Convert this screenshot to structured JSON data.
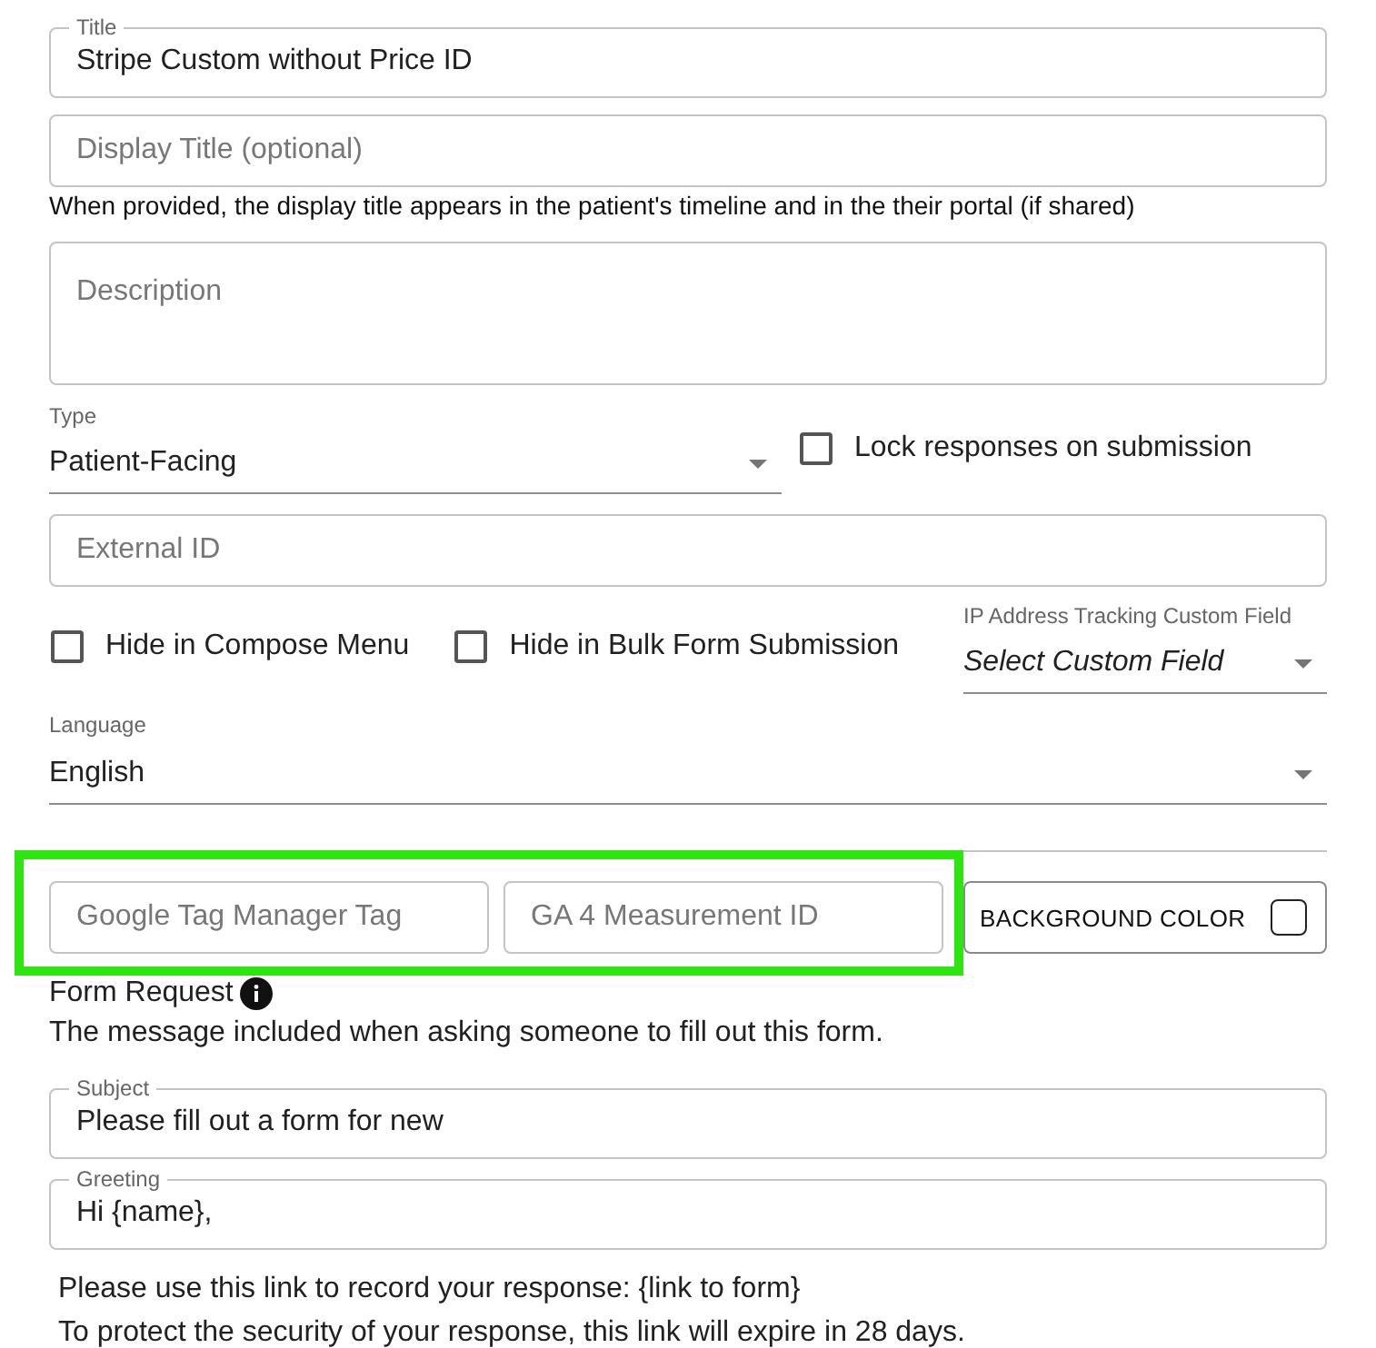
{
  "title_field": {
    "label": "Title",
    "value": "Stripe Custom without Price ID"
  },
  "display_title_field": {
    "placeholder": "Display Title (optional)",
    "helper": "When provided, the display title appears in the patient's timeline and in the their portal (if shared)"
  },
  "description_field": {
    "placeholder": "Description"
  },
  "type_select": {
    "label": "Type",
    "value": "Patient-Facing"
  },
  "lock_checkbox": {
    "label": "Lock responses on submission",
    "checked": false
  },
  "external_id_field": {
    "placeholder": "External ID"
  },
  "options": [
    {
      "label": "Hide in Compose Menu",
      "checked": false
    },
    {
      "label": "Hide in Bulk Form Submission",
      "checked": false
    }
  ],
  "ip_tracking_select": {
    "label": "IP Address Tracking Custom Field",
    "value": "Select Custom Field"
  },
  "language_select": {
    "label": "Language",
    "value": "English"
  },
  "tracking": {
    "highlighted": true,
    "fields": [
      {
        "placeholder": "Google Tag Manager Tag"
      },
      {
        "placeholder": "GA 4 Measurement ID"
      }
    ],
    "background_color_button": "BACKGROUND COLOR"
  },
  "form_request": {
    "heading": "Form Request",
    "description": "The message included when asking someone to fill out this form.",
    "subject": {
      "label": "Subject",
      "value": "Please fill out a form for new"
    },
    "greeting": {
      "label": "Greeting",
      "value": "Hi {name},"
    },
    "message_lines": [
      "Please use this link to record your response: {link to form}",
      "To protect the security of your response, this link will expire in 28 days."
    ]
  }
}
